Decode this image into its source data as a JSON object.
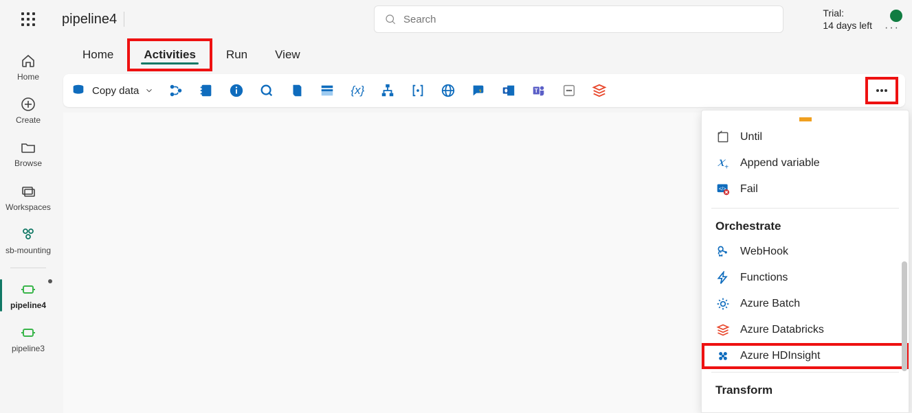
{
  "header": {
    "page_title": "pipeline4",
    "search_placeholder": "Search",
    "trial_line1": "Trial:",
    "trial_line2": "14 days left"
  },
  "rail": {
    "home": "Home",
    "create": "Create",
    "browse": "Browse",
    "workspaces": "Workspaces",
    "workspace_name": "sb-mounting",
    "pipeline_active": "pipeline4",
    "pipeline_other": "pipeline3"
  },
  "subnav": {
    "home": "Home",
    "activities": "Activities",
    "run": "Run",
    "view": "View"
  },
  "toolbar": {
    "copy_data": "Copy data",
    "variable_expr": "{x}"
  },
  "dropdown": {
    "item_until": "Until",
    "item_append": "Append variable",
    "item_fail": "Fail",
    "section_orchestrate": "Orchestrate",
    "item_webhook": "WebHook",
    "item_functions": "Functions",
    "item_azure_batch": "Azure Batch",
    "item_azure_databricks": "Azure Databricks",
    "item_azure_hdinsight": "Azure HDInsight",
    "section_transform": "Transform"
  }
}
